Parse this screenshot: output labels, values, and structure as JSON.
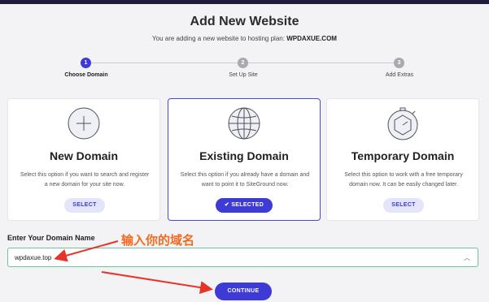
{
  "header": {
    "title": "Add New Website",
    "subtitle_prefix": "You are adding a new website to hosting plan:",
    "plan_name": "WPDAXUE.COM"
  },
  "stepper": {
    "steps": [
      {
        "number": "1",
        "label": "Choose Domain",
        "active": true
      },
      {
        "number": "2",
        "label": "Set Up Site",
        "active": false
      },
      {
        "number": "3",
        "label": "Add Extras",
        "active": false
      }
    ]
  },
  "options": [
    {
      "title": "New Domain",
      "description": "Select this option if you want to search and register a new domain for your site now.",
      "button_label": "SELECT",
      "icon": "plus-circle-icon",
      "selected": false
    },
    {
      "title": "Existing Domain",
      "description": "Select this option if you already have a domain and want to point it to SiteGround now.",
      "button_label": "SELECTED",
      "icon": "globe-icon",
      "selected": true
    },
    {
      "title": "Temporary Domain",
      "description": "Select this option to work with a free temporary domain now. It can be easily changed later.",
      "button_label": "SELECT",
      "icon": "stopwatch-icon",
      "selected": false
    }
  ],
  "domain_form": {
    "label": "Enter Your Domain Name",
    "value": "wpdaxue.top"
  },
  "continue_label": "CONTINUE",
  "annotation": {
    "text": "输入你的域名",
    "color": "#f26b21"
  },
  "colors": {
    "accent": "#3d3ad6",
    "field_border": "#6cc49a",
    "annotation_arrow": "#e8332a"
  }
}
